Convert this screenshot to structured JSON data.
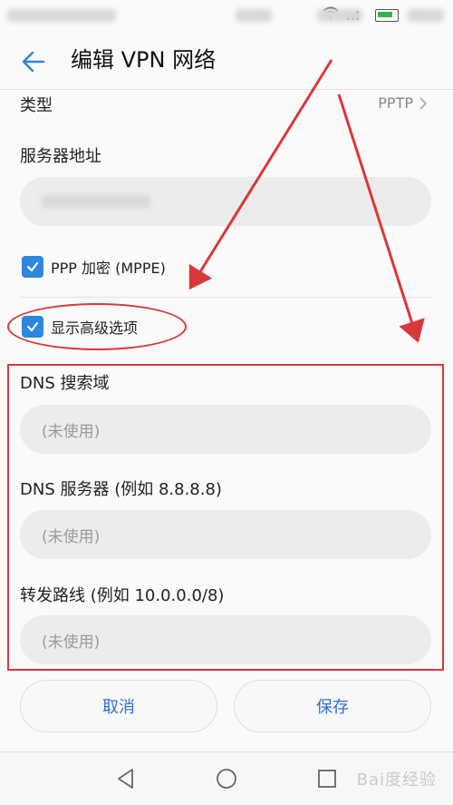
{
  "app": {
    "title": "编辑 VPN 网络"
  },
  "fields": {
    "type_label": "类型",
    "type_value": "PPTP",
    "server_label": "服务器地址",
    "dns_search_label": "DNS 搜索域",
    "dns_search_placeholder": "(未使用)",
    "dns_server_label": "DNS 服务器 (例如 8.8.8.8)",
    "dns_server_placeholder": "(未使用)",
    "routes_label": "转发路线 (例如 10.0.0.0/8)",
    "routes_placeholder": "(未使用)"
  },
  "checkboxes": {
    "ppp_encryption_label": "PPP 加密 (MPPE)",
    "ppp_encryption_checked": true,
    "advanced_label": "显示高级选项",
    "advanced_checked": true
  },
  "actions": {
    "cancel_label": "取消",
    "save_label": "保存"
  },
  "watermark": "Bai度经验",
  "colors": {
    "accent": "#2e86de",
    "annotation": "#d9383a",
    "button_text": "#2e6fd1"
  },
  "icons": [
    "back-arrow-icon",
    "chevron-right-icon",
    "checkmark-icon",
    "nav-back-icon",
    "nav-home-icon",
    "nav-recents-icon",
    "wifi-icon",
    "signal-icon",
    "battery-icon"
  ]
}
